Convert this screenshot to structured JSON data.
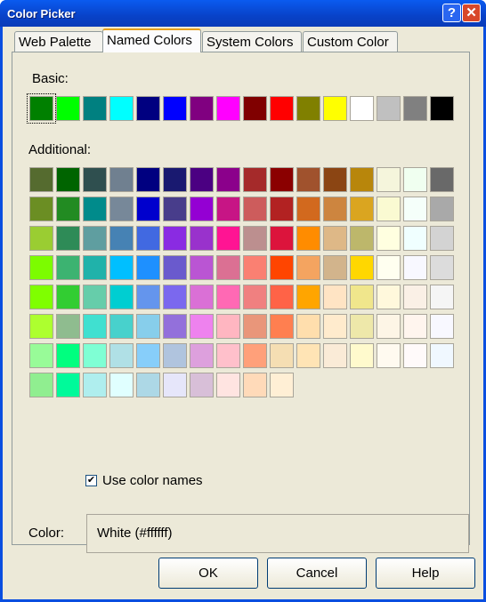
{
  "window": {
    "title": "Color Picker",
    "help_label": "?",
    "close_label": "✕"
  },
  "tabs": [
    {
      "label": "Web Palette"
    },
    {
      "label": "Named Colors",
      "active": true
    },
    {
      "label": "System Colors"
    },
    {
      "label": "Custom Color"
    }
  ],
  "basic": {
    "label": "Basic:",
    "colors": [
      "#008000",
      "#00ff00",
      "#008080",
      "#00ffff",
      "#000080",
      "#0000ff",
      "#800080",
      "#ff00ff",
      "#800000",
      "#ff0000",
      "#808000",
      "#ffff00",
      "#ffffff",
      "#c0c0c0",
      "#808080",
      "#000000"
    ],
    "selected": 0
  },
  "additional": {
    "label": "Additional:",
    "colors": [
      "#556b2f",
      "#006400",
      "#2f4f4f",
      "#708090",
      "#000080",
      "#191970",
      "#4b0082",
      "#8b008b",
      "#a52a2a",
      "#8b0000",
      "#a0522d",
      "#8b4513",
      "#b8860b",
      "#f5f5dc",
      "#f0fff0",
      "#696969",
      "#6b8e23",
      "#228b22",
      "#008b8b",
      "#778899",
      "#0000cd",
      "#483d8b",
      "#9400d3",
      "#c71585",
      "#cd5c5c",
      "#b22222",
      "#d2691e",
      "#cd853f",
      "#daa520",
      "#fafad2",
      "#f5fffa",
      "#a9a9a9",
      "#9acd32",
      "#2e8b57",
      "#5f9ea0",
      "#4682b4",
      "#4169e1",
      "#8a2be2",
      "#9932cc",
      "#ff1493",
      "#bc8f8f",
      "#dc143c",
      "#ff8c00",
      "#deb887",
      "#bdb76b",
      "#ffffe0",
      "#f0ffff",
      "#d3d3d3",
      "#7cfc00",
      "#3cb371",
      "#20b2aa",
      "#00bfff",
      "#1e90ff",
      "#6a5acd",
      "#ba55d3",
      "#db7093",
      "#fa8072",
      "#ff4500",
      "#f4a460",
      "#d2b48c",
      "#ffd700",
      "#fffff0",
      "#f8f8ff",
      "#dcdcdc",
      "#7fff00",
      "#32cd32",
      "#66cdaa",
      "#00ced1",
      "#6495ed",
      "#7b68ee",
      "#da70d6",
      "#ff69b4",
      "#f08080",
      "#ff6347",
      "#ffa500",
      "#ffe4c4",
      "#f0e68c",
      "#fff8dc",
      "#faf0e6",
      "#f5f5f5",
      "#adff2f",
      "#8fbc8f",
      "#40e0d0",
      "#48d1cc",
      "#87ceeb",
      "#9370db",
      "#ee82ee",
      "#ffb6c1",
      "#e9967a",
      "#ff7f50",
      "#ffdead",
      "#ffebcd",
      "#eee8aa",
      "#fdf5e6",
      "#fff5ee",
      "#f8f8ff",
      "#98fb98",
      "#00ff7f",
      "#7fffd4",
      "#b0e0e6",
      "#87cefa",
      "#b0c4de",
      "#dda0dd",
      "#ffc0cb",
      "#ffa07a",
      "#f5deb3",
      "#ffe4b5",
      "#faebd7",
      "#fffacd",
      "#fffaf0",
      "#fffafa",
      "#f0f8ff",
      "#90ee90",
      "#00fa9a",
      "#afeeee",
      "#e0ffff",
      "#add8e6",
      "#e6e6fa",
      "#d8bfd8",
      "#ffe4e1",
      "#ffdab9",
      "#ffefd5"
    ]
  },
  "use_names": {
    "label": "Use color names",
    "checked": true,
    "mark": "✔"
  },
  "color": {
    "label": "Color:",
    "value": "White (#ffffff)"
  },
  "buttons": {
    "ok": "OK",
    "cancel": "Cancel",
    "help": "Help"
  }
}
